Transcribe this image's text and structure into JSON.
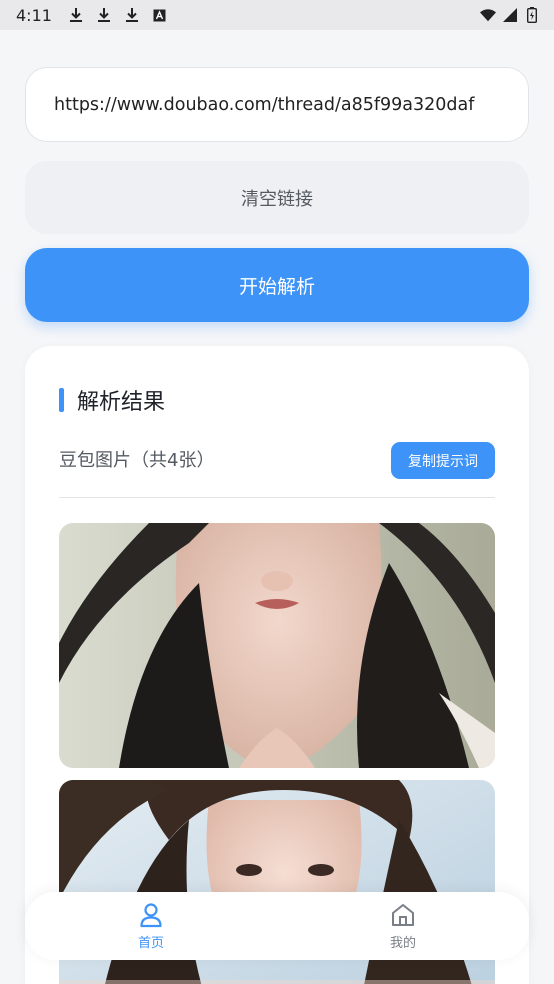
{
  "status_bar": {
    "time": "4:11",
    "left_icons": [
      "download-icon",
      "download-icon",
      "download-icon",
      "a-icon"
    ],
    "right_icons": [
      "wifi-icon",
      "signal-icon",
      "battery-icon"
    ]
  },
  "url_input": {
    "value": "https://www.doubao.com/thread/a85f99a320daf"
  },
  "buttons": {
    "clear_label": "清空链接",
    "parse_label": "开始解析",
    "copy_prompt_label": "复制提示词"
  },
  "result": {
    "title": "解析结果",
    "images_label": "豆包图片（共4张）"
  },
  "bottom_nav": {
    "items": [
      {
        "label": "首页",
        "icon": "user-icon",
        "active": true
      },
      {
        "label": "我的",
        "icon": "home-icon",
        "active": false
      }
    ]
  },
  "colors": {
    "accent": "#3d93f7",
    "page_background": "#f5f6f8"
  }
}
